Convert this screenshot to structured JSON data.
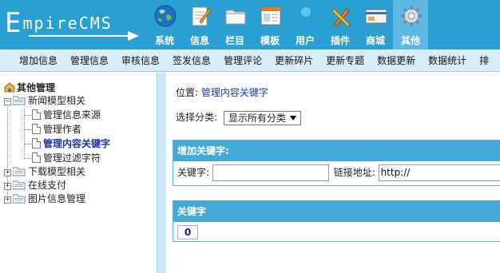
{
  "app": {
    "logo_text": "EmpireCMS"
  },
  "nav": {
    "items": [
      {
        "label": "系统",
        "icon": "globe-icon"
      },
      {
        "label": "信息",
        "icon": "edit-document-icon"
      },
      {
        "label": "栏目",
        "icon": "folder-icon"
      },
      {
        "label": "模板",
        "icon": "template-window-icon"
      },
      {
        "label": "用户",
        "icon": "user-icon"
      },
      {
        "label": "插件",
        "icon": "tools-icon"
      },
      {
        "label": "商城",
        "icon": "shop-card-icon"
      },
      {
        "label": "其他",
        "icon": "gear-icon"
      }
    ],
    "active_index": 7
  },
  "subnav": {
    "items": [
      "增加信息",
      "管理信息",
      "审核信息",
      "签发信息",
      "管理评论",
      "更新碎片",
      "更新专题",
      "数据更新",
      "数据统计",
      "排"
    ]
  },
  "sidebar": {
    "root_label": "其他管理",
    "group1": {
      "label": "新闻模型相关",
      "children": [
        "管理信息来源",
        "管理作者",
        "管理内容关键字",
        "管理过滤字符"
      ],
      "selected_index": 2
    },
    "groups_collapsed": [
      "下载模型相关",
      "在线支付",
      "图片信息管理"
    ]
  },
  "main": {
    "location_label": "位置:",
    "location_link": "管理内容关键字",
    "category_label": "选择分类:",
    "category_value": "显示所有分类",
    "add_panel": {
      "title": "增加关键字:",
      "keyword_label": "关键字:",
      "keyword_value": "",
      "url_label": "链接地址:",
      "url_value": "http://"
    },
    "list_panel": {
      "title": "关键字",
      "count": "0"
    }
  },
  "colors": {
    "header_bg": "#2a9fd2",
    "subnav_bg": "#d7eef9",
    "panel_head": "#43aad8",
    "link": "#1a3fa8"
  }
}
